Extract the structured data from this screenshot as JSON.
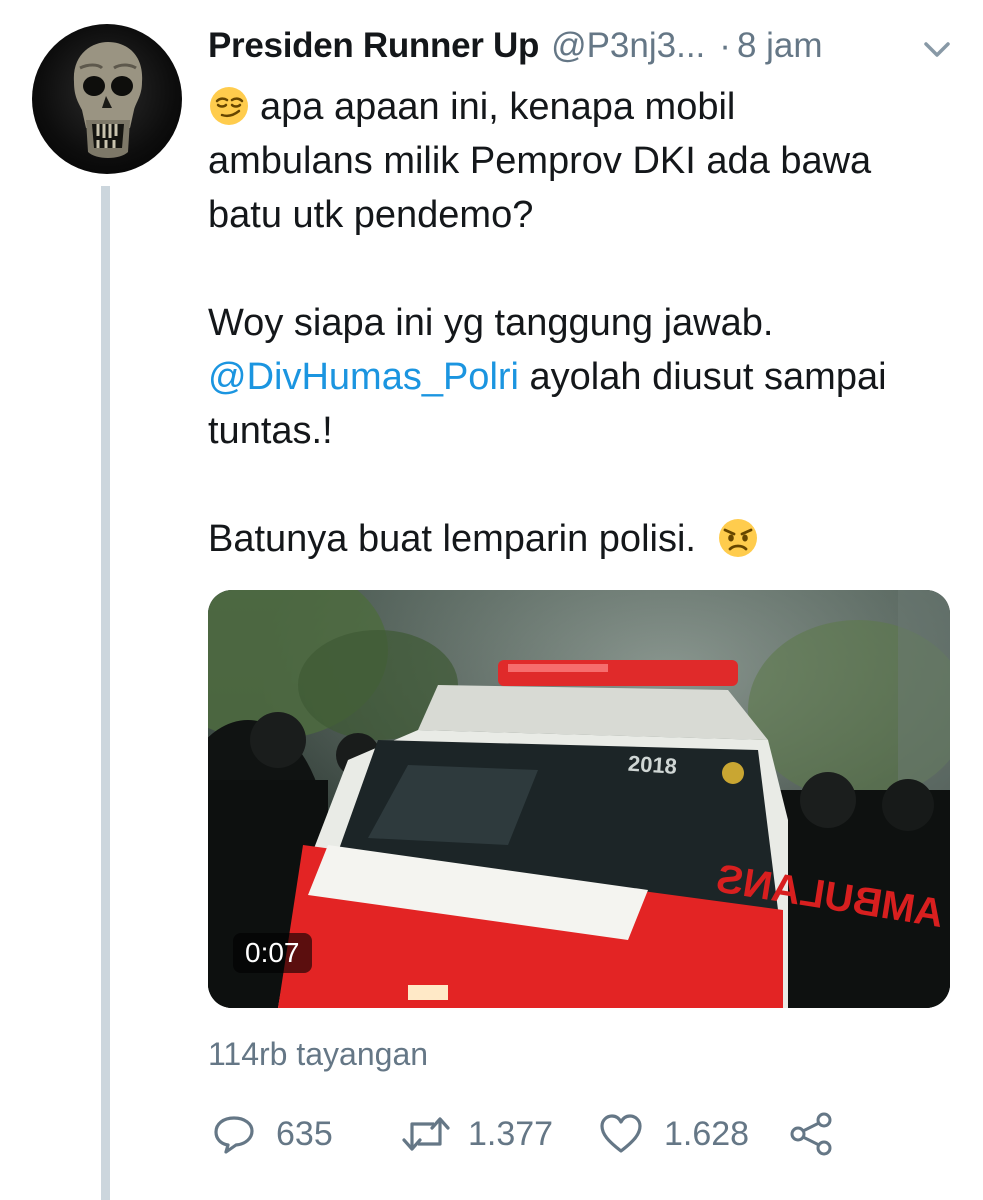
{
  "tweet": {
    "display_name": "Presiden Runner Up",
    "handle": "@P3nj3...",
    "dot": "·",
    "time": "8 jam",
    "text": {
      "line1": "apa apaan ini, kenapa mobil",
      "line2": "ambulans milik Pemprov DKI ada bawa",
      "line3": "batu utk pendemo?",
      "line4": "Woy siapa ini yg tanggung jawab.",
      "mention": "@DivHumas_Polri",
      "line5_rest": " ayolah diusut sampai",
      "line6": "tuntas.!",
      "line7": "Batunya buat lemparin polisi."
    },
    "emoji_start": "smirk-emoji",
    "emoji_end": "angry-emoji",
    "media": {
      "type": "video",
      "duration": "0:07",
      "overlay_text": "AMBULANS",
      "badge_text": "2018"
    },
    "views": "114rb tayangan",
    "actions": {
      "reply_count": "635",
      "retweet_count": "1.377",
      "like_count": "1.628"
    }
  },
  "colors": {
    "link": "#1b95e0",
    "secondary_text": "#657786",
    "thread_line": "#ccd6dd"
  },
  "icons": [
    "avatar-skull",
    "chevron-down-icon",
    "reply-icon",
    "retweet-icon",
    "heart-icon",
    "share-icon"
  ]
}
